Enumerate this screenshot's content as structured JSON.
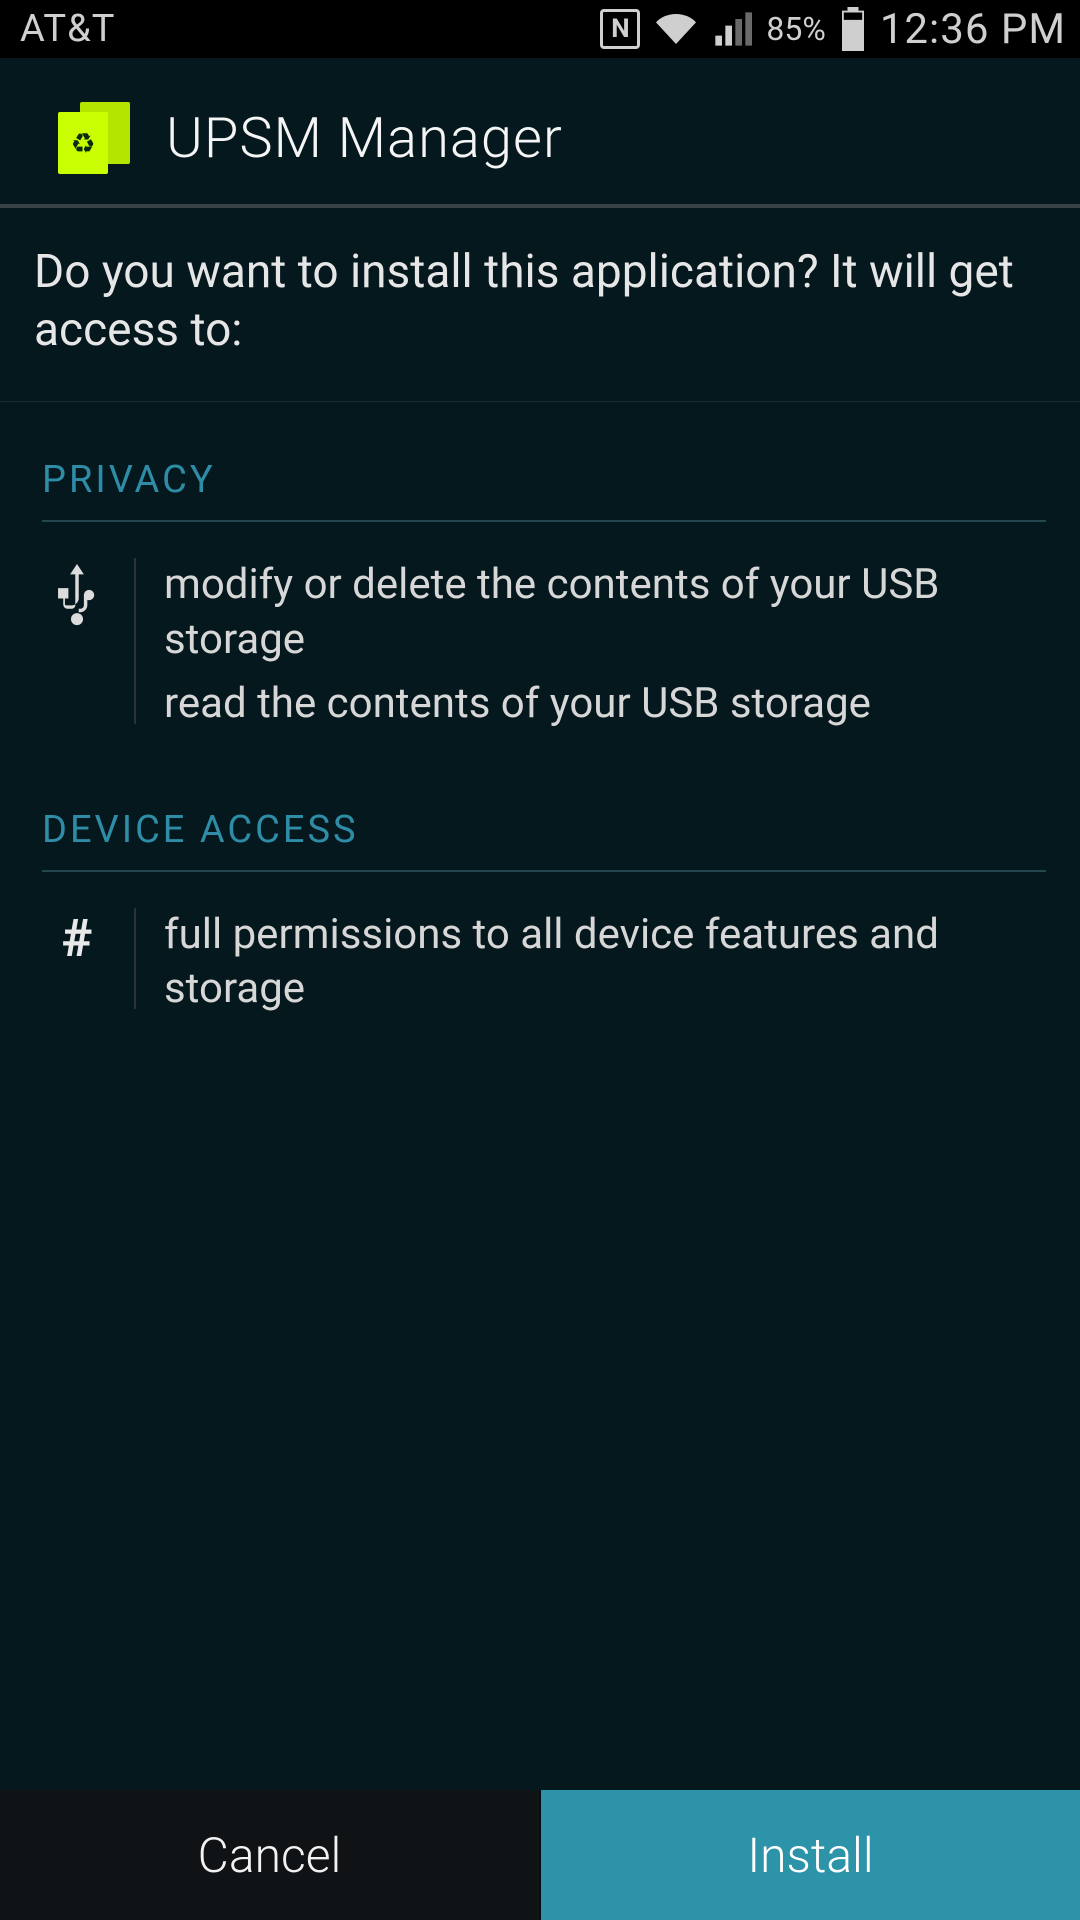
{
  "status_bar": {
    "carrier": "AT&T",
    "battery_percent": "85%",
    "time": "12:36 PM",
    "nfc_label": "N"
  },
  "installer": {
    "app_name": "UPSM Manager",
    "prompt_text": "Do you want to install this application? It will get access to:",
    "sections": [
      {
        "title": "PRIVACY",
        "icon": "usb-icon",
        "lines": [
          "modify or delete the contents of your USB storage",
          "read the contents of your USB storage"
        ]
      },
      {
        "title": "DEVICE ACCESS",
        "icon": "hash-icon",
        "lines": [
          "full permissions to all device features and storage"
        ]
      }
    ],
    "buttons": {
      "cancel": "Cancel",
      "install": "Install"
    }
  }
}
